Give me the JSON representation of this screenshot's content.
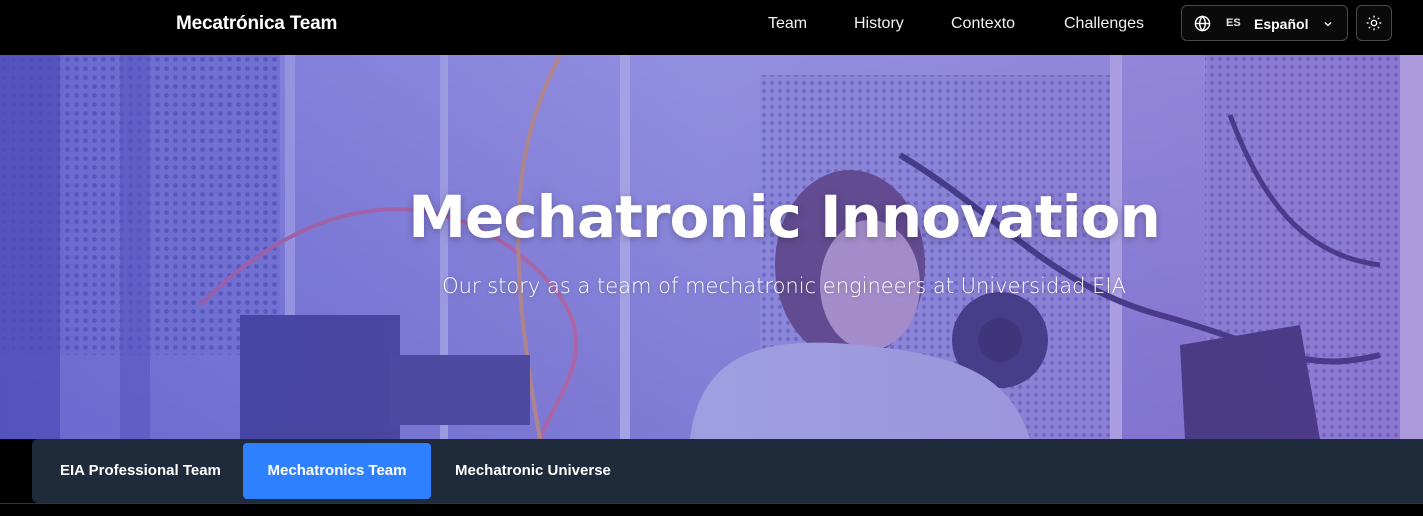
{
  "navbar": {
    "brand": "Mecatrónica Team",
    "links": [
      "Team",
      "History",
      "Contexto",
      "Challenges"
    ],
    "language": {
      "code": "ES",
      "name": "Español"
    }
  },
  "hero": {
    "title": "Mechatronic Innovation",
    "subtitle": "Our story as a team of mechatronic engineers at Universidad EIA"
  },
  "tabs": [
    {
      "label": "EIA Professional Team",
      "active": false
    },
    {
      "label": "Mechatronics Team",
      "active": true
    },
    {
      "label": "Mechatronic Universe",
      "active": false
    }
  ],
  "colors": {
    "navbar_bg": "#000000",
    "tabbar_bg": "#1f2a3a",
    "active_tab": "#2f80ff",
    "hero_tint": "#6f6fc9"
  },
  "icons": {
    "language": "globe-icon",
    "dropdown": "chevron-down-icon",
    "theme": "sun-icon"
  }
}
